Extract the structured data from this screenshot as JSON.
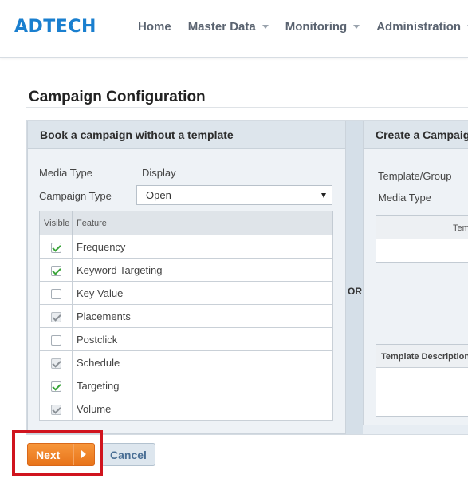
{
  "brand": {
    "logo_text": "ADTECH",
    "logo_color": "#1a7fcf"
  },
  "nav": {
    "items": [
      {
        "label": "Home",
        "has_dropdown": false
      },
      {
        "label": "Master Data",
        "has_dropdown": true
      },
      {
        "label": "Monitoring",
        "has_dropdown": true
      },
      {
        "label": "Administration",
        "has_dropdown": true
      }
    ]
  },
  "page": {
    "title": "Campaign Configuration"
  },
  "left_panel": {
    "title": "Book a campaign without a template",
    "media_type_label": "Media Type",
    "media_type_value": "Display",
    "campaign_type_label": "Campaign Type",
    "campaign_type_selected": "Open",
    "table": {
      "columns": [
        "Visible",
        "Feature"
      ],
      "rows": [
        {
          "feature": "Frequency",
          "checked": true,
          "disabled": false
        },
        {
          "feature": "Keyword Targeting",
          "checked": true,
          "disabled": false
        },
        {
          "feature": "Key Value",
          "checked": false,
          "disabled": false
        },
        {
          "feature": "Placements",
          "checked": true,
          "disabled": true
        },
        {
          "feature": "Postclick",
          "checked": false,
          "disabled": false
        },
        {
          "feature": "Schedule",
          "checked": true,
          "disabled": true
        },
        {
          "feature": "Targeting",
          "checked": true,
          "disabled": false
        },
        {
          "feature": "Volume",
          "checked": true,
          "disabled": true
        }
      ]
    }
  },
  "separator_label": "OR",
  "right_panel": {
    "title": "Create a Campaign",
    "template_group_label": "Template/Group",
    "media_type_label": "Media Type",
    "template_table_header": "Tem",
    "template_description_header": "Template Description"
  },
  "actions": {
    "next_label": "Next",
    "cancel_label": "Cancel"
  },
  "colors": {
    "accent_orange": "#f0852a",
    "highlight_red": "#d0141e",
    "check_green": "#3aa53a"
  }
}
